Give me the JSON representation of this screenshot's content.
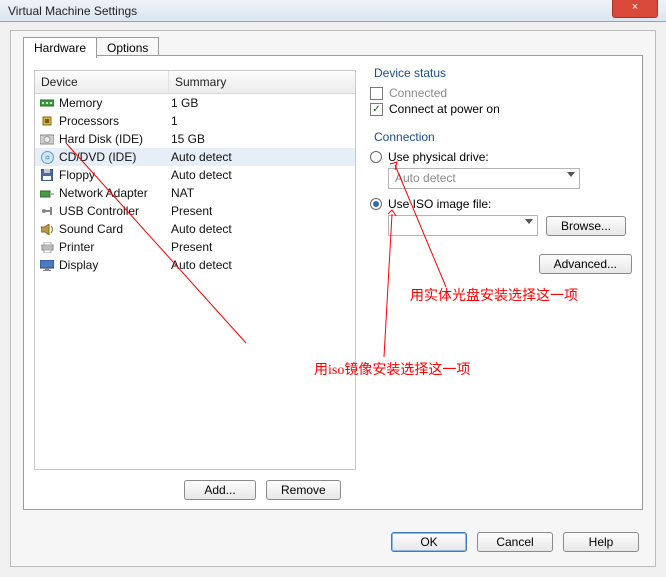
{
  "window": {
    "title": "Virtual Machine Settings",
    "close_glyph": "×"
  },
  "tabs": {
    "hardware": "Hardware",
    "options": "Options"
  },
  "columns": {
    "device": "Device",
    "summary": "Summary"
  },
  "devices": [
    {
      "name": "Memory",
      "summary": "1 GB",
      "icon": "mem"
    },
    {
      "name": "Processors",
      "summary": "1",
      "icon": "cpu"
    },
    {
      "name": "Hard Disk (IDE)",
      "summary": "15 GB",
      "icon": "hdd"
    },
    {
      "name": "CD/DVD (IDE)",
      "summary": "Auto detect",
      "icon": "cd",
      "selected": true
    },
    {
      "name": "Floppy",
      "summary": "Auto detect",
      "icon": "flp"
    },
    {
      "name": "Network Adapter",
      "summary": "NAT",
      "icon": "net"
    },
    {
      "name": "USB Controller",
      "summary": "Present",
      "icon": "usb"
    },
    {
      "name": "Sound Card",
      "summary": "Auto detect",
      "icon": "snd"
    },
    {
      "name": "Printer",
      "summary": "Present",
      "icon": "prn"
    },
    {
      "name": "Display",
      "summary": "Auto detect",
      "icon": "dsp"
    }
  ],
  "buttons": {
    "add": "Add...",
    "remove": "Remove",
    "browse": "Browse...",
    "advanced": "Advanced...",
    "ok": "OK",
    "cancel": "Cancel",
    "help": "Help"
  },
  "status": {
    "group": "Device status",
    "connected": "Connected",
    "connected_checked": false,
    "connected_enabled": false,
    "power_on": "Connect at power on",
    "power_on_checked": true
  },
  "connection": {
    "group": "Connection",
    "physical": "Use physical drive:",
    "physical_drive": "Auto detect",
    "iso": "Use ISO image file:",
    "iso_value": "",
    "selected": "iso"
  },
  "annotations": {
    "physical_note": "用实体光盘安装选择这一项",
    "iso_note": "用iso镜像安装选择这一项"
  }
}
